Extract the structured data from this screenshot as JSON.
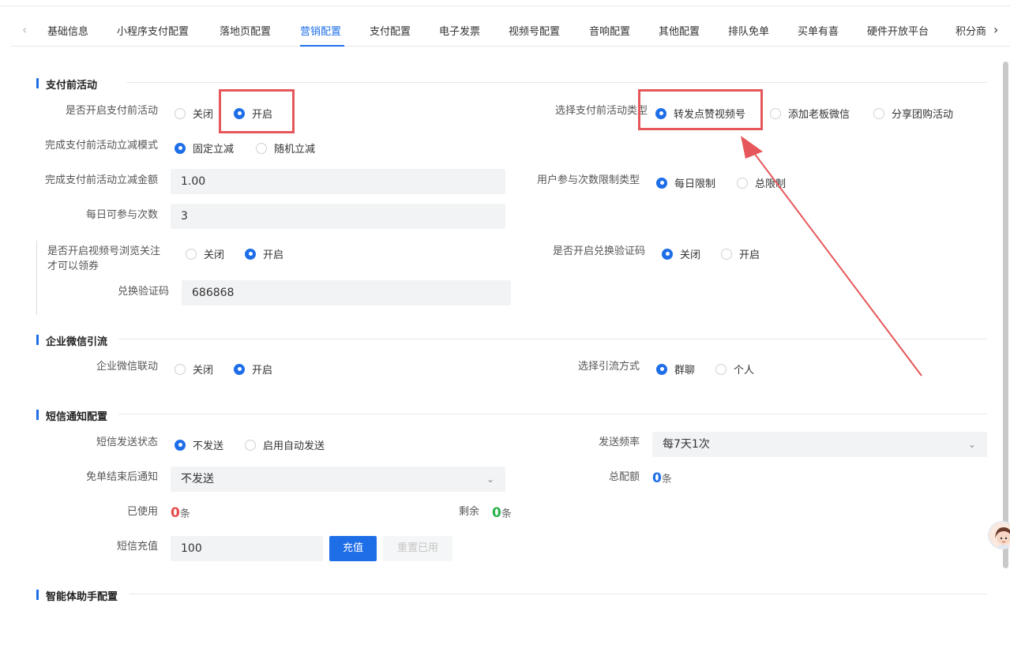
{
  "tabs": {
    "items": [
      "基础信息",
      "小程序支付配置",
      "落地页配置",
      "营销配置",
      "支付配置",
      "电子发票",
      "视频号配置",
      "音响配置",
      "其他配置",
      "排队免单",
      "买单有喜",
      "硬件开放平台",
      "积分商"
    ],
    "active": "营销配置"
  },
  "pre_payment": {
    "title": "支付前活动",
    "enable_label": "是否开启支付前活动",
    "enable_options": [
      "关闭",
      "开启"
    ],
    "enable_selected": "开启",
    "mode_label": "完成支付前活动立减模式",
    "mode_options": [
      "固定立减",
      "随机立减"
    ],
    "mode_selected": "固定立减",
    "amount_label": "完成支付前活动立减金额",
    "amount_value": "1.00",
    "daily_label": "每日可参与次数",
    "daily_value": "3",
    "type_label": "选择支付前活动类型",
    "type_options": [
      "转发点赞视频号",
      "添加老板微信",
      "分享团购活动"
    ],
    "type_selected": "转发点赞视频号",
    "limit_label": "用户参与次数限制类型",
    "limit_options": [
      "每日限制",
      "总限制"
    ],
    "limit_selected": "每日限制",
    "channel_follow_label_line1": "是否开启视频号浏览关注",
    "channel_follow_label_line2": "才可以领券",
    "channel_follow_options": [
      "关闭",
      "开启"
    ],
    "channel_follow_selected": "开启",
    "verify_label": "是否开启兑换验证码",
    "verify_options": [
      "关闭",
      "开启"
    ],
    "verify_selected": "关闭",
    "code_label": "兑换验证码",
    "code_value": "686868"
  },
  "wecom": {
    "title": "企业微信引流",
    "link_label": "企业微信联动",
    "link_options": [
      "关闭",
      "开启"
    ],
    "link_selected": "开启",
    "method_label": "选择引流方式",
    "method_options": [
      "群聊",
      "个人"
    ],
    "method_selected": "群聊"
  },
  "sms": {
    "title": "短信通知配置",
    "status_label": "短信发送状态",
    "status_options": [
      "不发送",
      "启用自动发送"
    ],
    "status_selected": "不发送",
    "freq_label": "发送频率",
    "freq_value": "每7天1次",
    "end_notice_label": "免单结束后通知",
    "end_notice_value": "不发送",
    "total_label": "总配额",
    "total_value": "0",
    "used_label": "已使用",
    "used_value": "0",
    "remain_label": "剩余",
    "remain_value": "0",
    "unit": "条",
    "recharge_label": "短信充值",
    "recharge_value": "100",
    "recharge_button": "充值",
    "reset_button": "重置已用"
  },
  "ai": {
    "title": "智能体助手配置"
  },
  "colors": {
    "accent": "#1e6ee8",
    "annotation_red": "#e5575a",
    "used_red": "#e84c4c",
    "remain_green": "#2bb24c"
  }
}
